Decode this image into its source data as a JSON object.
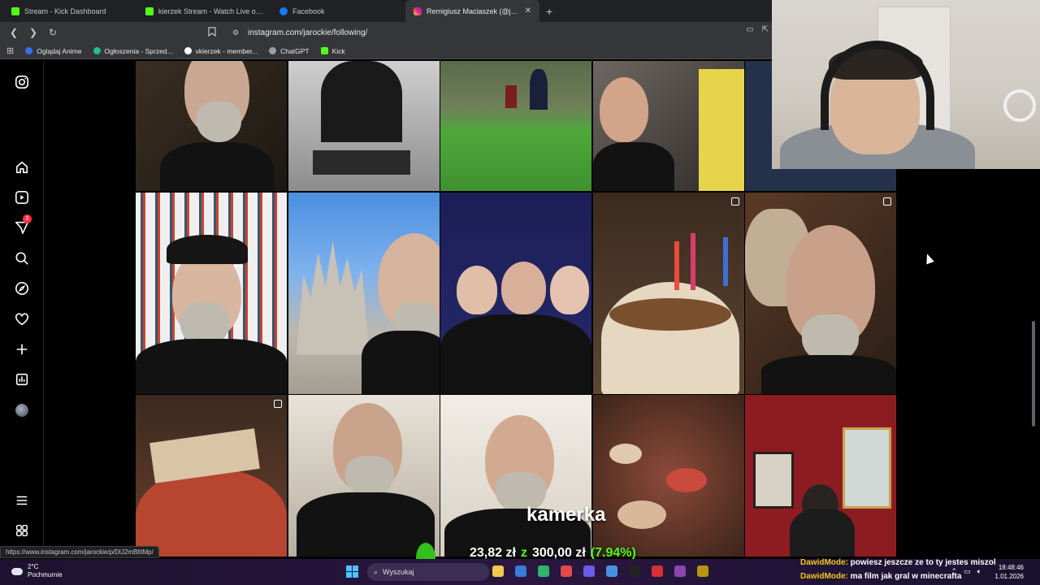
{
  "browser": {
    "tabs": [
      {
        "title": "Stream - Kick Dashboard",
        "icon": "kick",
        "active": false
      },
      {
        "title": "kierzek Stream - Watch Live on K",
        "icon": "kick",
        "active": false
      },
      {
        "title": "Facebook",
        "icon": "facebook",
        "active": false
      },
      {
        "title": "Remigiusz Maciaszek (@jarocki",
        "icon": "instagram",
        "active": true
      }
    ],
    "url": "instagram.com/jarockie/following/",
    "bookmarks": [
      {
        "label": "Oglądaj Anime",
        "color": "#3a6df0"
      },
      {
        "label": "Ogłoszenia - Sprzed...",
        "color": "#1fbf8f"
      },
      {
        "label": "vkierzek - member...",
        "color": "#ffffff"
      },
      {
        "label": "ChatGPT",
        "color": "#9aa0a6"
      },
      {
        "label": "Kick",
        "color": "#53fc18"
      }
    ],
    "status_url": "https://www.instagram.com/jarockie/p/DlJ2mBltIMp/"
  },
  "instagram": {
    "notification_count": "3",
    "sidebar_icons": [
      "instagram-logo-icon",
      "home-icon",
      "reels-icon",
      "messages-icon",
      "search-icon",
      "explore-icon",
      "notifications-icon",
      "create-icon",
      "dashboard-icon",
      "profile-avatar",
      "menu-icon",
      "more-icon"
    ]
  },
  "overlay": {
    "camera_label": "kamerka",
    "donation_current": "23,82 zł",
    "donation_sep": "z",
    "donation_goal": "300,00 zł",
    "donation_percent": "(7.94%)",
    "progress_fraction": 0.0794
  },
  "chat": [
    {
      "user": "DawidMode:",
      "message": "powiesz jeszcze ze to ty jestes miszol"
    },
    {
      "user": "DawidMode:",
      "message": "ma film jak gral w minecrafta"
    }
  ],
  "taskbar": {
    "temperature": "2°C",
    "weather": "Pochmurnie",
    "search_placeholder": "Wyszukaj",
    "time": "18:48:46",
    "date": "1.01.2026"
  }
}
